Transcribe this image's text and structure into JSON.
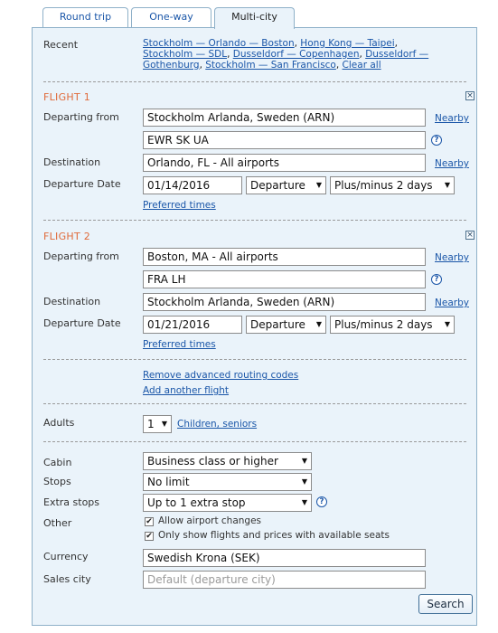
{
  "tabs": [
    {
      "label": "Round trip"
    },
    {
      "label": "One-way"
    },
    {
      "label": "Multi-city"
    }
  ],
  "recent": {
    "label": "Recent",
    "links": [
      "Stockholm — Orlando — Boston",
      "Hong Kong — Taipei",
      "Stockholm — SDL",
      "Dusseldorf — Copenhagen",
      "Dusseldorf — Gothenburg",
      "Stockholm — San Francisco",
      "Clear all"
    ]
  },
  "flights": [
    {
      "title": "FLIGHT 1",
      "departing_label": "Departing from",
      "departing_value": "Stockholm Arlanda, Sweden (ARN)",
      "routing_value": "EWR SK UA",
      "destination_label": "Destination",
      "destination_value": "Orlando, FL - All airports",
      "date_label": "Departure Date",
      "date_value": "01/14/2016",
      "type_value": "Departure",
      "range_value": "Plus/minus 2 days",
      "preferred_times": "Preferred times",
      "nearby": "Nearby"
    },
    {
      "title": "FLIGHT 2",
      "departing_label": "Departing from",
      "departing_value": "Boston, MA - All airports",
      "routing_value": "FRA LH",
      "destination_label": "Destination",
      "destination_value": "Stockholm Arlanda, Sweden (ARN)",
      "date_label": "Departure Date",
      "date_value": "01/21/2016",
      "type_value": "Departure",
      "range_value": "Plus/minus 2 days",
      "preferred_times": "Preferred times",
      "nearby": "Nearby"
    }
  ],
  "actions": {
    "remove_codes": "Remove advanced routing codes",
    "add_flight": "Add another flight"
  },
  "adults": {
    "label": "Adults",
    "value": "1",
    "children_link": "Children, seniors"
  },
  "options": {
    "cabin_label": "Cabin",
    "cabin_value": "Business class or higher",
    "stops_label": "Stops",
    "stops_value": "No limit",
    "extra_stops_label": "Extra stops",
    "extra_stops_value": "Up to 1 extra stop",
    "other_label": "Other",
    "allow_airport_changes": "Allow airport changes",
    "only_available": "Only show flights and prices with available seats",
    "currency_label": "Currency",
    "currency_value": "Swedish Krona (SEK)",
    "sales_city_label": "Sales city",
    "sales_city_placeholder": "Default (departure city)"
  },
  "search_label": "Search",
  "icons": {
    "help": "?",
    "close": "×",
    "check": "✔",
    "caret": "▼"
  }
}
